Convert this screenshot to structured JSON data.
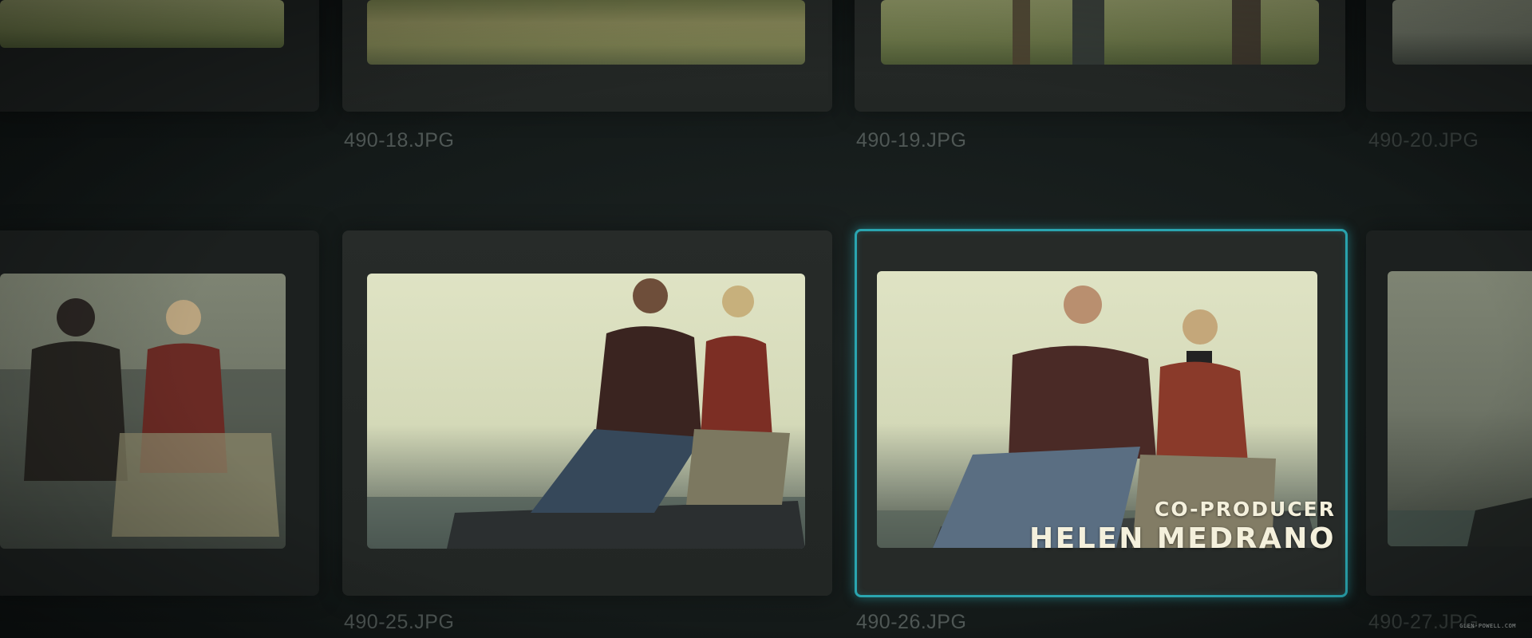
{
  "files": {
    "row1": [
      "490-18.JPG",
      "490-19.JPG",
      "490-20.JPG"
    ],
    "row2": [
      "490-25.JPG",
      "490-26.JPG",
      "490-27.JPG"
    ]
  },
  "credits": {
    "role": "CO-PRODUCER",
    "name": "HELEN MEDRANO"
  },
  "watermark": "GLEN-POWELL.COM",
  "colors": {
    "selection": "#2aa5b0",
    "credit_text": "#f4f0dc",
    "filename_text": "#4f5755"
  },
  "selected_file": "490-26.JPG"
}
